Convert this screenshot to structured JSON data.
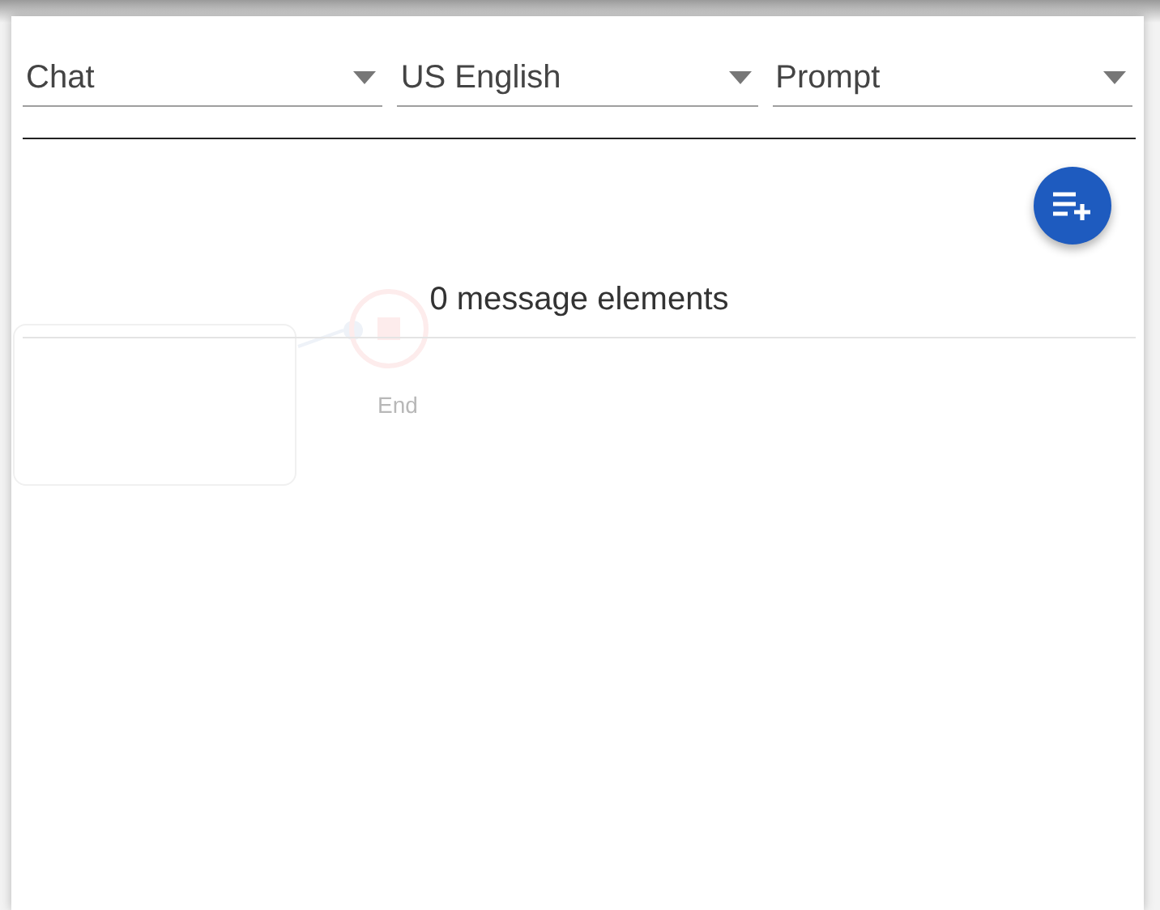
{
  "selects": [
    {
      "value": "Chat"
    },
    {
      "value": "US English"
    },
    {
      "value": "Prompt"
    }
  ],
  "message_count": "0 message elements",
  "background_node": {
    "label": "End"
  }
}
